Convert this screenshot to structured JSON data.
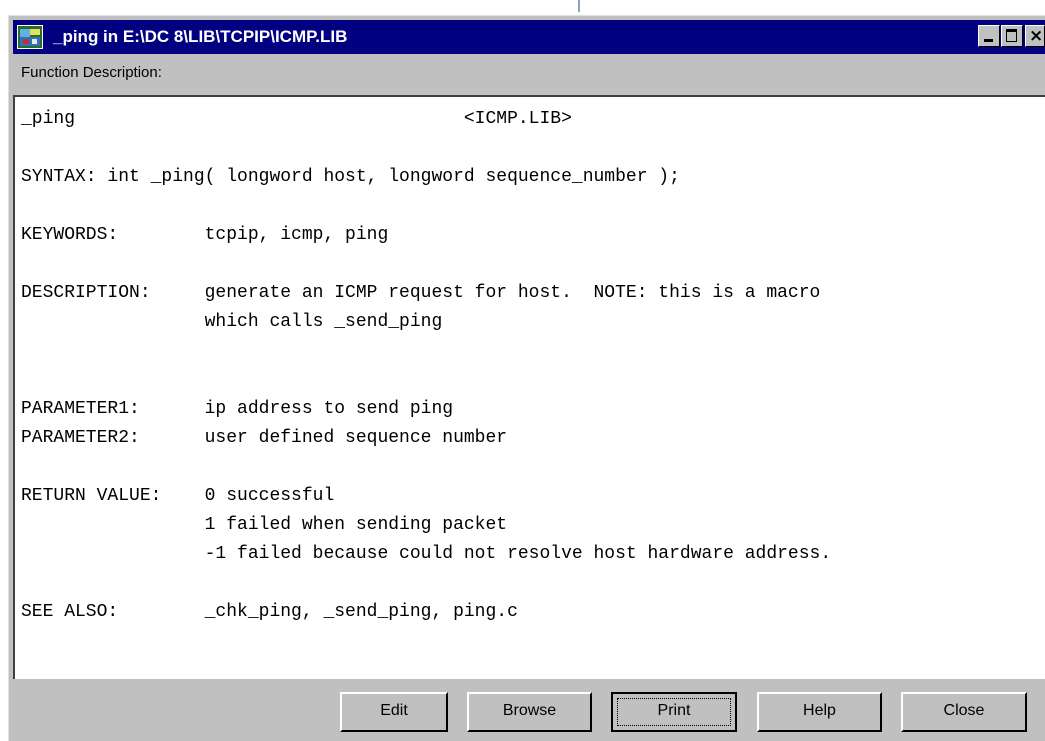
{
  "window": {
    "title": "_ping in E:\\DC 8\\LIB\\TCPIP\\ICMP.LIB",
    "icon": "application-icon",
    "controls": [
      "minimize",
      "maximize",
      "close"
    ]
  },
  "function_description_label": "Function Description:",
  "description_text": "_ping                                    <ICMP.LIB>\n\nSYNTAX: int _ping( longword host, longword sequence_number );\n\nKEYWORDS:        tcpip, icmp, ping\n\nDESCRIPTION:     generate an ICMP request for host.  NOTE: this is a macro\n                 which calls _send_ping\n\n\nPARAMETER1:      ip address to send ping\nPARAMETER2:      user defined sequence number\n\nRETURN VALUE:    0 successful\n                 1 failed when sending packet\n                 -1 failed because could not resolve host hardware address.\n\nSEE ALSO:        _chk_ping, _send_ping, ping.c",
  "buttons": {
    "edit": "Edit",
    "browse": "Browse",
    "print": "Print",
    "help": "Help",
    "close": "Close"
  },
  "colors": {
    "titlebar": "#000080",
    "face": "#c0c0c0"
  }
}
